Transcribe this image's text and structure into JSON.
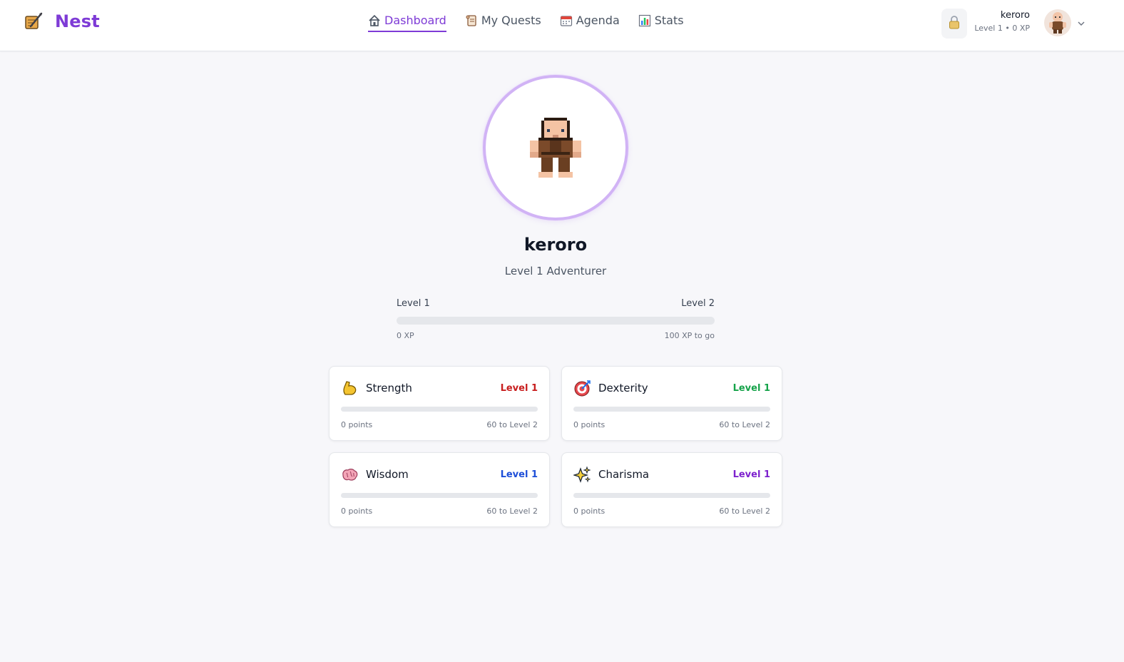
{
  "app": {
    "name": "Nest",
    "logo_icon": "quill-notebook-icon"
  },
  "nav": [
    {
      "label": "Dashboard",
      "icon": "home-icon",
      "active": true
    },
    {
      "label": "My Quests",
      "icon": "scroll-icon",
      "active": false
    },
    {
      "label": "Agenda",
      "icon": "calendar-icon",
      "active": false
    },
    {
      "label": "Stats",
      "icon": "bar-chart-icon",
      "active": false
    }
  ],
  "user": {
    "name": "keroro",
    "summary": "Level 1 • 0 XP"
  },
  "profile": {
    "name": "keroro",
    "title": "Level 1 Adventurer",
    "xp": {
      "current_label": "Level 1",
      "next_label": "Level 2",
      "xp_label": "0 XP",
      "to_go_label": "100 XP to go",
      "progress_percent": 0
    }
  },
  "stats": [
    {
      "name": "Strength",
      "icon": "flexed-biceps-icon",
      "level_label": "Level 1",
      "level_color": "#c81e1e",
      "points_label": "0 points",
      "next_label": "60 to Level 2",
      "progress_percent": 0,
      "bar_color": "#ef4444"
    },
    {
      "name": "Dexterity",
      "icon": "target-icon",
      "level_label": "Level 1",
      "level_color": "#16a34a",
      "points_label": "0 points",
      "next_label": "60 to Level 2",
      "progress_percent": 0,
      "bar_color": "#22c55e"
    },
    {
      "name": "Wisdom",
      "icon": "brain-icon",
      "level_label": "Level 1",
      "level_color": "#1d4ed8",
      "points_label": "0 points",
      "next_label": "60 to Level 2",
      "progress_percent": 0,
      "bar_color": "#3b82f6"
    },
    {
      "name": "Charisma",
      "icon": "sparkles-icon",
      "level_label": "Level 1",
      "level_color": "#7e22ce",
      "points_label": "0 points",
      "next_label": "60 to Level 2",
      "progress_percent": 0,
      "bar_color": "#a855f7"
    }
  ],
  "colors": {
    "accent": "#7e3bd6",
    "ring": "#d1b3f5",
    "background": "#f7f7fa"
  }
}
